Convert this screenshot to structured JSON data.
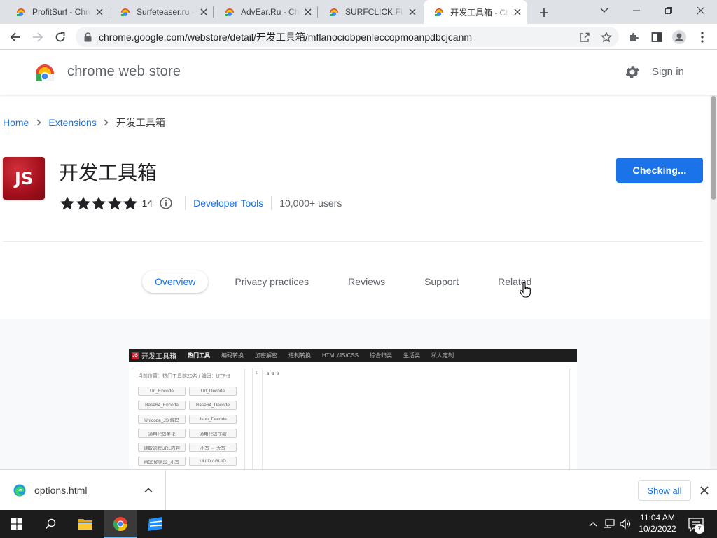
{
  "browser": {
    "tabs": [
      {
        "title": "ProfitSurf - Chrome Web Store"
      },
      {
        "title": "Surfeteaser.ru - Chrome Web Store"
      },
      {
        "title": "AdvEar.Ru - Chrome Web Store"
      },
      {
        "title": "SURFCLICK.FUN - Chrome Web Store"
      },
      {
        "title": "开发工具箱 - Chrome Web Store"
      }
    ],
    "url": "chrome.google.com/webstore/detail/开发工具箱/mflanociobpenleccopmoanpdbcjcanm"
  },
  "store": {
    "name": "chrome web store",
    "signin": "Sign in"
  },
  "breadcrumb": {
    "home": "Home",
    "extensions": "Extensions",
    "current": "开发工具箱"
  },
  "extension": {
    "icon_text": "JS",
    "title": "开发工具箱",
    "button": "Checking...",
    "rating": 5,
    "rating_count": "14",
    "category": "Developer Tools",
    "users": "10,000+ users"
  },
  "section_tabs": [
    {
      "label": "Overview",
      "active": true
    },
    {
      "label": "Privacy practices",
      "active": false
    },
    {
      "label": "Reviews",
      "active": false
    },
    {
      "label": "Support",
      "active": false
    },
    {
      "label": "Related",
      "active": false
    }
  ],
  "screenshot": {
    "logo": "JS",
    "app_name": "开发工具箱",
    "menu": [
      "热门工具",
      "编码转换",
      "加密解密",
      "进制转换",
      "HTML/JS/CSS",
      "综合归类",
      "生活类",
      "私人定制"
    ],
    "location": "当前位置：热门工具前20名  /  编码：UTF-8",
    "buttons": [
      "Url_Encode",
      "Url_Decode",
      "Base64_Encode",
      "Base64_Decode",
      "Unicode_JS 解码",
      "Json_Decode",
      "通用代码美化",
      "通用代码压缩",
      "读取远程URL内容",
      "小写 → 大写",
      "MD5加密32_小写",
      "UUID / GUID"
    ],
    "line_number": "1",
    "code": "s s s"
  },
  "download": {
    "filename": "options.html",
    "show_all": "Show all"
  },
  "taskbar": {
    "time": "11:04 AM",
    "date": "10/2/2022",
    "notification_count": "7"
  },
  "colors": {
    "accent": "#1a73e8",
    "extension_icon": "#b3131f",
    "taskbar": "#1c1c1c"
  }
}
